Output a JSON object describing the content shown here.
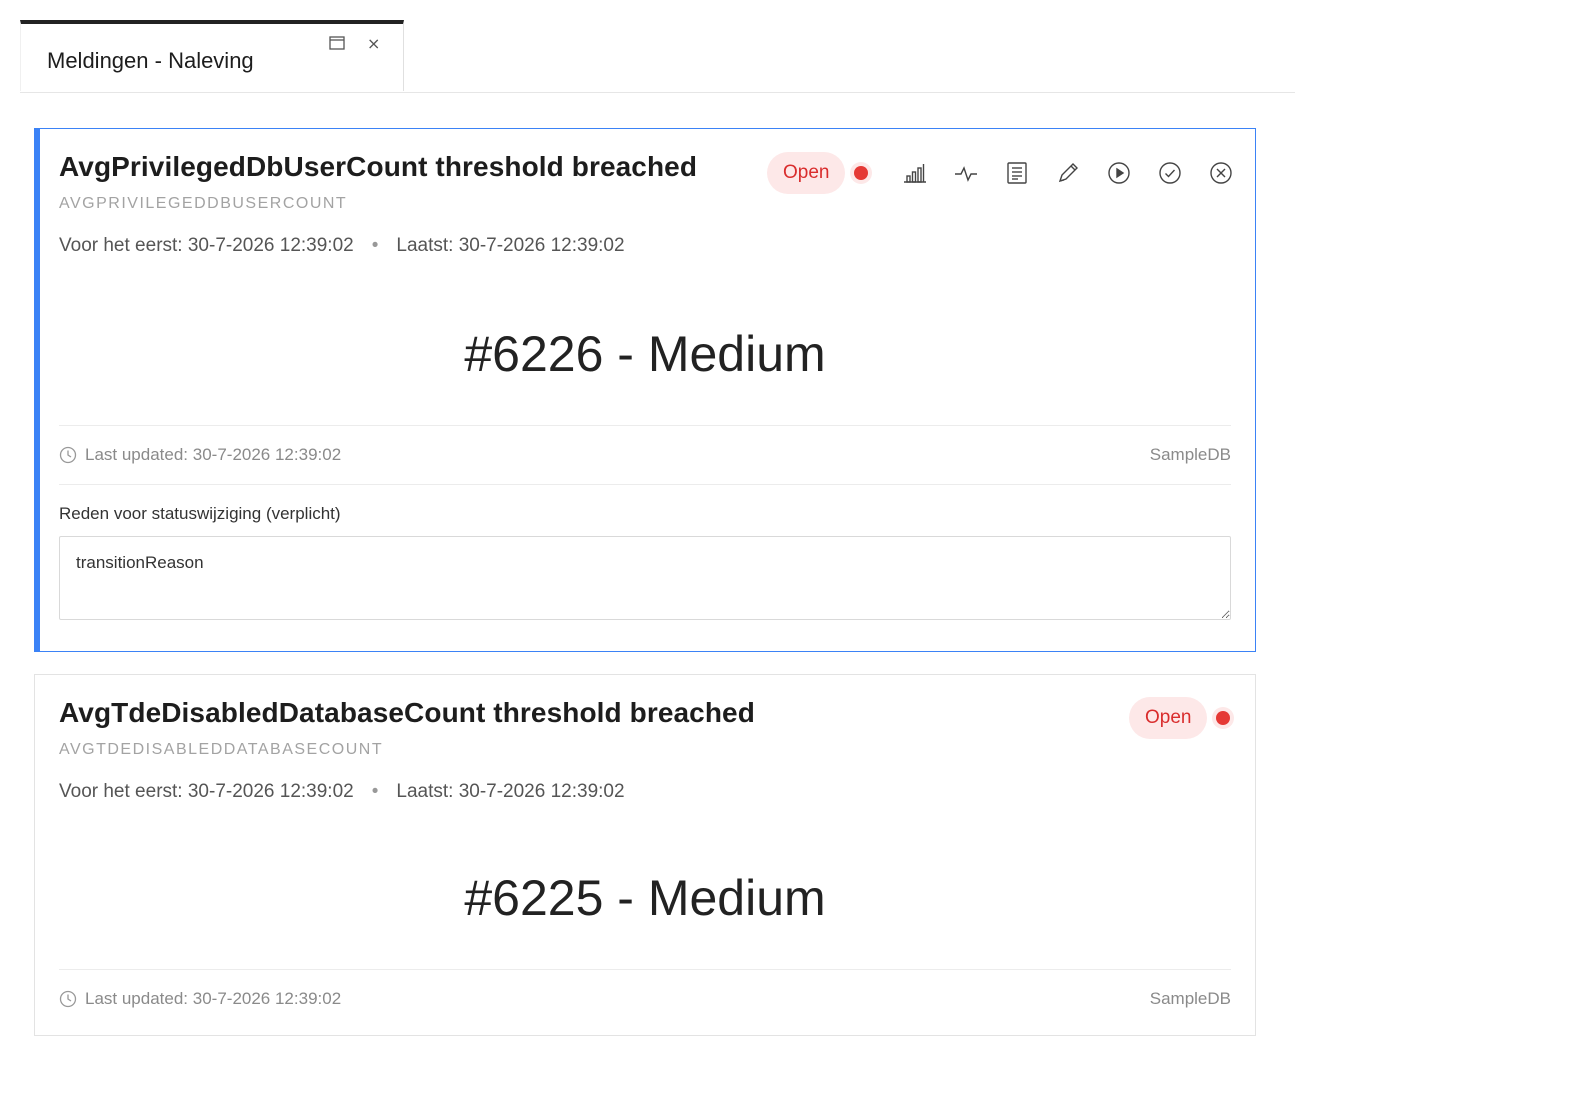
{
  "tab": {
    "title": "Meldingen - Naleving",
    "close_glyph": "×"
  },
  "alerts": [
    {
      "title": "AvgPrivilegedDbUserCount threshold breached",
      "code": "AVGPRIVILEGEDDBUSERCOUNT",
      "first_seen": "Voor het eerst: 30-7-2026 12:39:02",
      "last_seen": "Laatst: 30-7-2026 12:39:02",
      "separator": "•",
      "headline": "#6226 - Medium",
      "last_updated": "Last updated: 30-7-2026 12:39:02",
      "source": "SampleDB",
      "status": "Open",
      "selected": true,
      "reason_label": "Reden voor statuswijziging (verplicht)",
      "reason_value": "transitionReason",
      "actions": [
        "bar-chart-icon",
        "activity-icon",
        "list-icon",
        "pencil-icon",
        "play-icon",
        "check-circle-icon",
        "x-circle-icon"
      ]
    },
    {
      "title": "AvgTdeDisabledDatabaseCount threshold breached",
      "code": "AVGTDEDISABLEDDATABASECOUNT",
      "first_seen": "Voor het eerst: 30-7-2026 12:39:02",
      "last_seen": "Laatst: 30-7-2026 12:39:02",
      "separator": "•",
      "headline": "#6225 - Medium",
      "last_updated": "Last updated: 30-7-2026 12:39:02",
      "source": "SampleDB",
      "status": "Open",
      "selected": false
    }
  ],
  "colors": {
    "accent": "#3b82f6",
    "status_open_text": "#d92d2d",
    "status_open_bg": "#fde8e8",
    "status_dot": "#e53935"
  }
}
